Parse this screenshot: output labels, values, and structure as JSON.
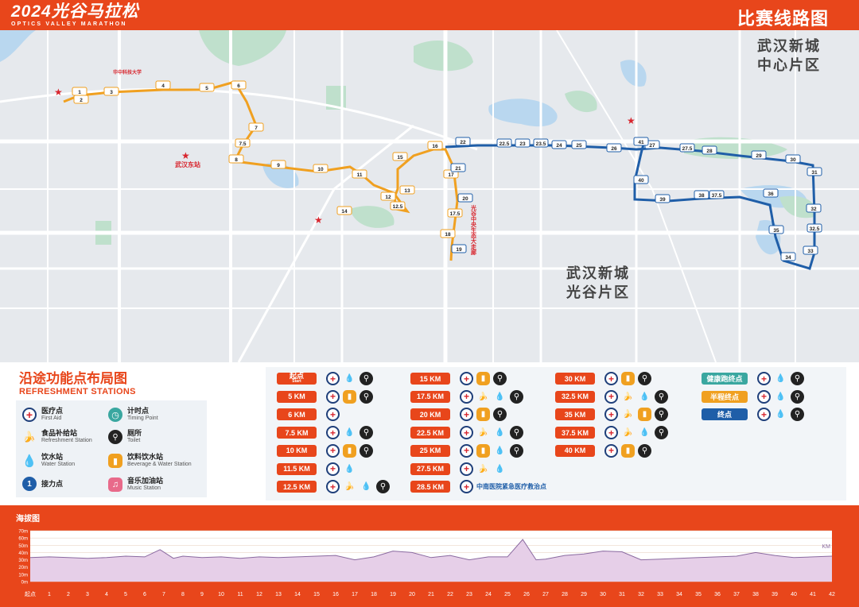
{
  "header": {
    "title": "2024光谷马拉松",
    "subtitle": "OPTICS VALLEY MARATHON",
    "page_title": "比赛线路图"
  },
  "map": {
    "district_north": [
      "武汉新城",
      "中心片区"
    ],
    "district_south": [
      "武汉新城",
      "光谷片区"
    ],
    "landmarks": {
      "wuhan_east_station": "武汉东站",
      "corridor": "光谷中央生态大走廊",
      "university": "华中科技大学"
    },
    "km_markers": [
      "1",
      "2",
      "3",
      "4",
      "5",
      "6",
      "7",
      "7.5",
      "8",
      "9",
      "10",
      "11",
      "12",
      "12.5",
      "13",
      "14",
      "15",
      "16",
      "17",
      "17.5",
      "18",
      "19",
      "20",
      "21",
      "22",
      "22.5",
      "23",
      "23.5",
      "24",
      "25",
      "26",
      "27",
      "27.5",
      "28",
      "29",
      "30",
      "31",
      "32",
      "32.5",
      "33",
      "34",
      "35",
      "36",
      "37.5",
      "38",
      "39",
      "40",
      "41"
    ],
    "colors": {
      "route_first_half": "#f0a020",
      "route_second_half": "#1f5ea8",
      "water": "#b9d7ef",
      "park": "#bfe0cc",
      "road": "#ffffff"
    }
  },
  "stations": {
    "title_zh": "沿途功能点布局图",
    "title_en": "REFRESHMENT STATIONS",
    "legend": [
      {
        "icon": "first-aid-icon",
        "zh": "医疗点",
        "en": "First Aid"
      },
      {
        "icon": "timing-icon",
        "zh": "计时点",
        "en": "Timing Point"
      },
      {
        "icon": "food-icon",
        "zh": "食品补给站",
        "en": "Refreshment Station"
      },
      {
        "icon": "toilet-icon",
        "zh": "厕所",
        "en": "Toilet"
      },
      {
        "icon": "water-icon",
        "zh": "饮水站",
        "en": "Water Station"
      },
      {
        "icon": "beverage-icon",
        "zh": "饮料饮水站",
        "en": "Beverage & Water Station"
      },
      {
        "icon": "relay-icon",
        "zh": "接力点",
        "en": ""
      },
      {
        "icon": "music-icon",
        "zh": "音乐加油站",
        "en": "Music Station"
      }
    ],
    "col1": [
      {
        "label": "起点",
        "sub": "Start",
        "icons": [
          "aid",
          "water",
          "toilet"
        ]
      },
      {
        "label": "5 KM",
        "icons": [
          "aid",
          "bev",
          "toilet"
        ]
      },
      {
        "label": "6 KM",
        "icons": [
          "aid"
        ]
      },
      {
        "label": "7.5 KM",
        "icons": [
          "aid",
          "water",
          "toilet"
        ]
      },
      {
        "label": "10 KM",
        "icons": [
          "aid",
          "bev",
          "toilet"
        ]
      },
      {
        "label": "11.5 KM",
        "icons": [
          "aid",
          "water"
        ]
      },
      {
        "label": "12.5 KM",
        "icons": [
          "aid",
          "food",
          "water",
          "toilet"
        ]
      }
    ],
    "col2": [
      {
        "label": "15 KM",
        "icons": [
          "aid",
          "bev",
          "toilet"
        ]
      },
      {
        "label": "17.5 KM",
        "icons": [
          "aid",
          "food",
          "water",
          "toilet"
        ]
      },
      {
        "label": "20 KM",
        "icons": [
          "aid",
          "bev",
          "toilet"
        ]
      },
      {
        "label": "22.5 KM",
        "icons": [
          "aid",
          "food",
          "water",
          "toilet"
        ]
      },
      {
        "label": "25 KM",
        "icons": [
          "aid",
          "bev",
          "water",
          "toilet"
        ]
      },
      {
        "label": "27.5 KM",
        "icons": [
          "aid",
          "food",
          "water"
        ]
      },
      {
        "label": "28.5 KM",
        "icons": [
          "aid"
        ],
        "note": "中南医院紧急医疗救治点"
      }
    ],
    "col3": [
      {
        "label": "30 KM",
        "icons": [
          "aid",
          "bev",
          "toilet"
        ]
      },
      {
        "label": "32.5 KM",
        "icons": [
          "aid",
          "food",
          "water",
          "toilet"
        ]
      },
      {
        "label": "35 KM",
        "icons": [
          "aid",
          "food",
          "bev",
          "toilet"
        ]
      },
      {
        "label": "37.5 KM",
        "icons": [
          "aid",
          "food",
          "water",
          "toilet"
        ]
      },
      {
        "label": "40 KM",
        "icons": [
          "aid",
          "bev",
          "toilet"
        ]
      }
    ],
    "col4": [
      {
        "label": "健康跑终点",
        "style": "teal",
        "icons": [
          "aid",
          "water",
          "toilet"
        ]
      },
      {
        "label": "半程终点",
        "style": "orange",
        "icons": [
          "aid",
          "water",
          "toilet"
        ]
      },
      {
        "label": "终点",
        "style": "blue",
        "icons": [
          "aid",
          "water",
          "toilet"
        ]
      }
    ]
  },
  "elevation": {
    "title": "海拔图",
    "unit": "KM",
    "y_ticks": [
      "70m",
      "60m",
      "50m",
      "40m",
      "30m",
      "20m",
      "10m",
      "0m"
    ],
    "x_ticks": [
      "起点",
      "1",
      "2",
      "3",
      "4",
      "5",
      "6",
      "7",
      "8",
      "9",
      "10",
      "11",
      "12",
      "13",
      "14",
      "15",
      "16",
      "17",
      "18",
      "19",
      "20",
      "21",
      "22",
      "23",
      "24",
      "25",
      "26",
      "27",
      "28",
      "29",
      "30",
      "31",
      "32",
      "33",
      "34",
      "35",
      "36",
      "37",
      "38",
      "39",
      "40",
      "41",
      "42"
    ],
    "profile_km": [
      0,
      1,
      2,
      3,
      4,
      5,
      6,
      6.8,
      7.5,
      8,
      9,
      10,
      11,
      12,
      13,
      14,
      15,
      16,
      17,
      18,
      19,
      20,
      21,
      22,
      23,
      24,
      25,
      25.8,
      26.5,
      27,
      28,
      29,
      30,
      31,
      32,
      33,
      34,
      35,
      36,
      37,
      38,
      39,
      40,
      41,
      42
    ],
    "profile_m": [
      33,
      34,
      33,
      32,
      33,
      35,
      34,
      44,
      32,
      35,
      33,
      34,
      32,
      34,
      33,
      34,
      35,
      36,
      30,
      34,
      42,
      40,
      33,
      36,
      30,
      34,
      34,
      58,
      30,
      31,
      36,
      38,
      42,
      41,
      30,
      31,
      32,
      33,
      34,
      35,
      40,
      36,
      33,
      34,
      35
    ],
    "fill_color": "#e6cfe8",
    "line_color": "#8a6aa0"
  }
}
